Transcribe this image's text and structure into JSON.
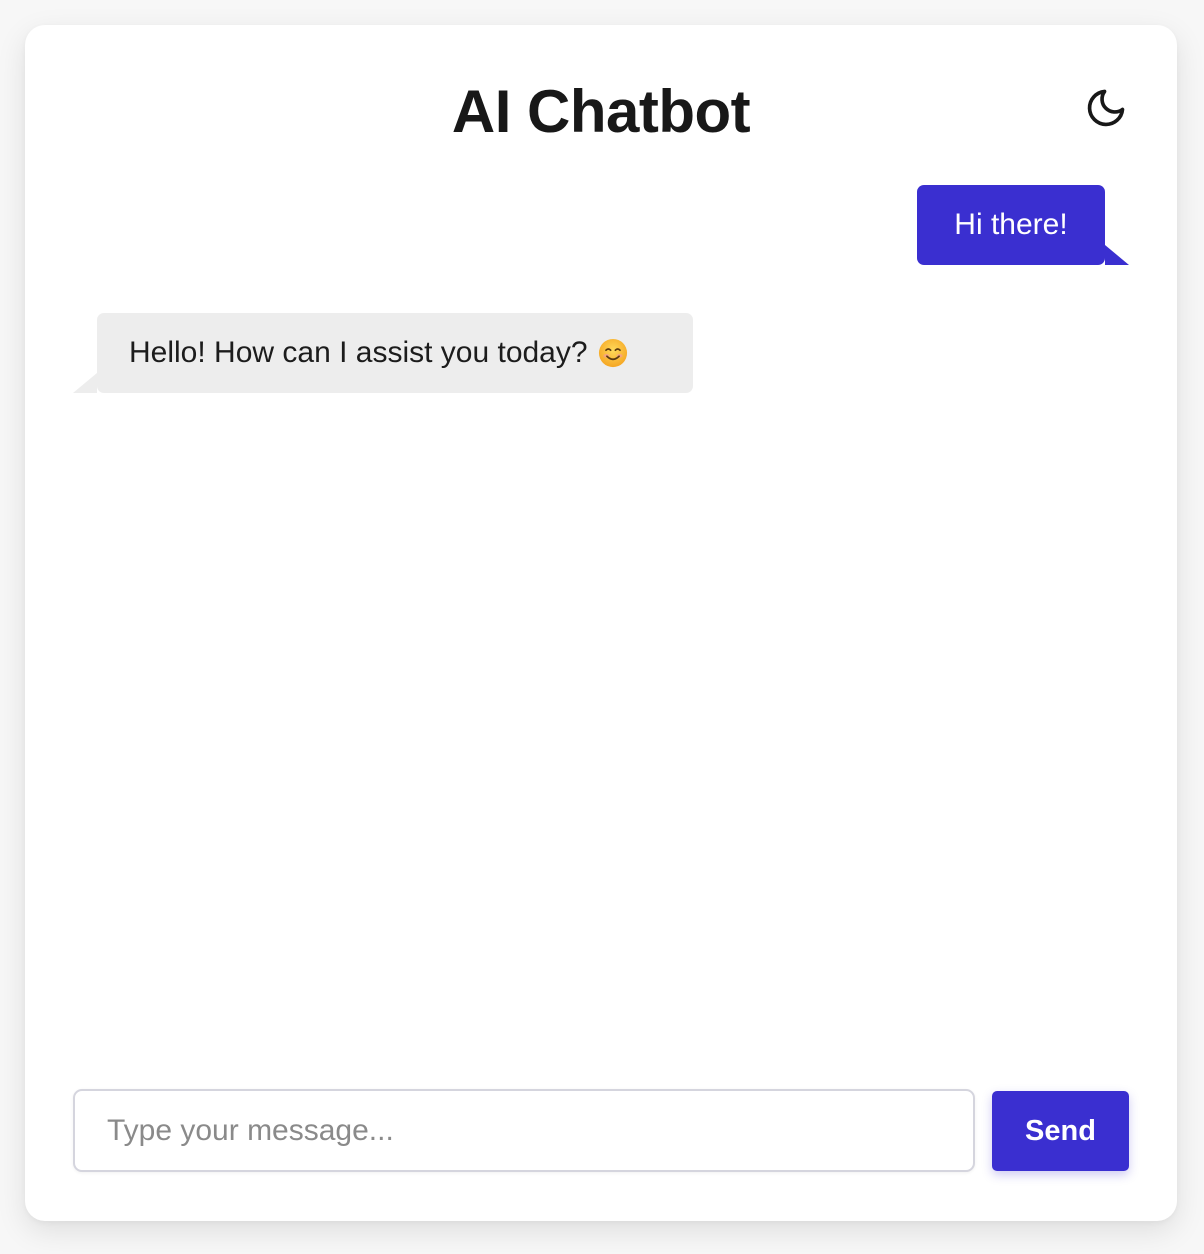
{
  "header": {
    "title": "AI Chatbot",
    "theme_toggle_icon": "moon-icon"
  },
  "messages": [
    {
      "role": "user",
      "text": "Hi there!"
    },
    {
      "role": "bot",
      "text": "Hello! How can I assist you today?",
      "emoji": "smiling-face-icon"
    }
  ],
  "composer": {
    "placeholder": "Type your message...",
    "value": "",
    "send_label": "Send"
  },
  "colors": {
    "accent": "#3a2fd0",
    "bot_bubble": "#ededed",
    "background": "#f7f7f7",
    "card": "#ffffff"
  }
}
